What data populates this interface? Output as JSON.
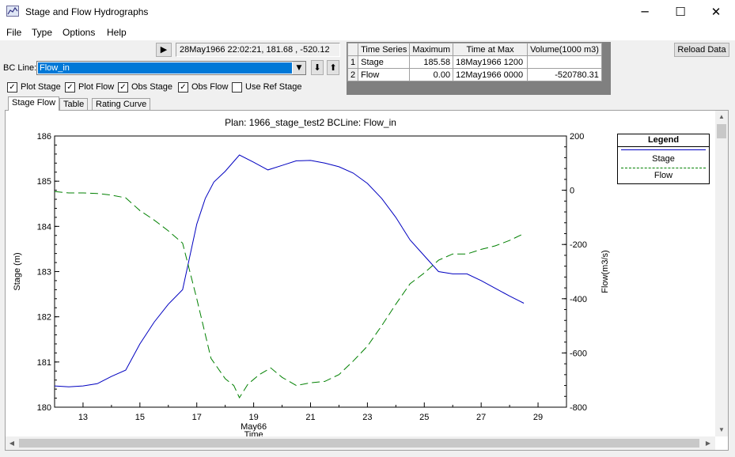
{
  "window": {
    "title": "Stage and Flow Hydrographs",
    "minimize": "─",
    "maximize": "☐",
    "close": "✕"
  },
  "menu": [
    "File",
    "Type",
    "Options",
    "Help"
  ],
  "toolbar": {
    "play": "▶",
    "readout": "28May1966  22:02:21, 181.68 , -520.12",
    "bc_label": "BC Line:",
    "bc_value": "Flow_in",
    "down": "⬇",
    "up": "⬆",
    "reload": "Reload Data"
  },
  "checks": [
    {
      "label": "Plot Stage",
      "checked": true
    },
    {
      "label": "Plot Flow",
      "checked": true
    },
    {
      "label": "Obs Stage",
      "checked": true
    },
    {
      "label": "Obs Flow",
      "checked": true
    },
    {
      "label": "Use Ref Stage",
      "checked": false
    }
  ],
  "checkmark": "✓",
  "tabs": [
    "Stage Flow",
    "Table",
    "Rating Curve"
  ],
  "summary_table": {
    "headers": [
      "Time Series",
      "Maximum",
      "Time at Max",
      "Volume(1000 m3)"
    ],
    "rows": [
      {
        "n": "1",
        "series": "Stage",
        "max": "185.58",
        "time": "18May1966  1200",
        "vol": ""
      },
      {
        "n": "2",
        "series": "Flow",
        "max": "0.00",
        "time": "12May1966  0000",
        "vol": "-520780.31"
      }
    ]
  },
  "scroll": {
    "up": "▲",
    "down": "▼",
    "left": "◀",
    "right": "▶"
  },
  "chart_data": {
    "type": "line",
    "title": "Plan: 1966_stage_test2    BCLine: Flow_in",
    "xlabel": "Time",
    "x_sublabel": "May66",
    "ylabel": "Stage (m)",
    "y2label": "Flow(m3/s)",
    "xlim": [
      12,
      30
    ],
    "ylim": [
      180,
      186
    ],
    "y2lim": [
      -800,
      200
    ],
    "xticks": [
      13,
      15,
      17,
      19,
      21,
      23,
      25,
      27,
      29
    ],
    "yticks": [
      180,
      181,
      182,
      183,
      184,
      185,
      186
    ],
    "y2ticks": [
      -800,
      -600,
      -400,
      -200,
      0,
      200
    ],
    "legend": {
      "title": "Legend",
      "placement": "top-right"
    },
    "series": [
      {
        "name": "Stage",
        "axis": "left",
        "color": "#0000c0",
        "style": "solid",
        "x": [
          12.0,
          12.5,
          13.0,
          13.5,
          14.0,
          14.5,
          15.0,
          15.5,
          16.0,
          16.5,
          17.0,
          17.3,
          17.6,
          18.0,
          18.5,
          19.0,
          19.5,
          20.0,
          20.5,
          21.0,
          21.5,
          22.0,
          22.5,
          23.0,
          23.5,
          24.0,
          24.5,
          25.0,
          25.5,
          26.0,
          26.5,
          27.0,
          27.5,
          28.0,
          28.5
        ],
        "y": [
          180.47,
          180.45,
          180.47,
          180.52,
          180.68,
          180.82,
          181.4,
          181.88,
          182.28,
          182.6,
          184.05,
          184.62,
          184.98,
          185.22,
          185.58,
          185.42,
          185.25,
          185.35,
          185.45,
          185.46,
          185.4,
          185.32,
          185.18,
          184.95,
          184.62,
          184.2,
          183.7,
          183.35,
          183.0,
          182.95,
          182.95,
          182.8,
          182.63,
          182.46,
          182.3
        ]
      },
      {
        "name": "Flow",
        "axis": "right",
        "color": "#008000",
        "style": "dashed",
        "x": [
          12.0,
          12.5,
          13.0,
          13.5,
          14.0,
          14.5,
          15.0,
          15.5,
          16.0,
          16.5,
          17.0,
          17.5,
          18.0,
          18.3,
          18.5,
          18.8,
          19.2,
          19.6,
          20.0,
          20.5,
          21.0,
          21.5,
          22.0,
          22.5,
          23.0,
          23.5,
          24.0,
          24.5,
          25.0,
          25.5,
          26.0,
          26.5,
          27.0,
          27.5,
          28.0,
          28.5
        ],
        "y": [
          -5,
          -10,
          -10,
          -12,
          -18,
          -28,
          -75,
          -110,
          -150,
          -195,
          -400,
          -620,
          -695,
          -720,
          -765,
          -715,
          -680,
          -655,
          -690,
          -720,
          -710,
          -705,
          -680,
          -630,
          -575,
          -500,
          -420,
          -345,
          -305,
          -258,
          -235,
          -235,
          -218,
          -205,
          -185,
          -160
        ]
      }
    ]
  }
}
